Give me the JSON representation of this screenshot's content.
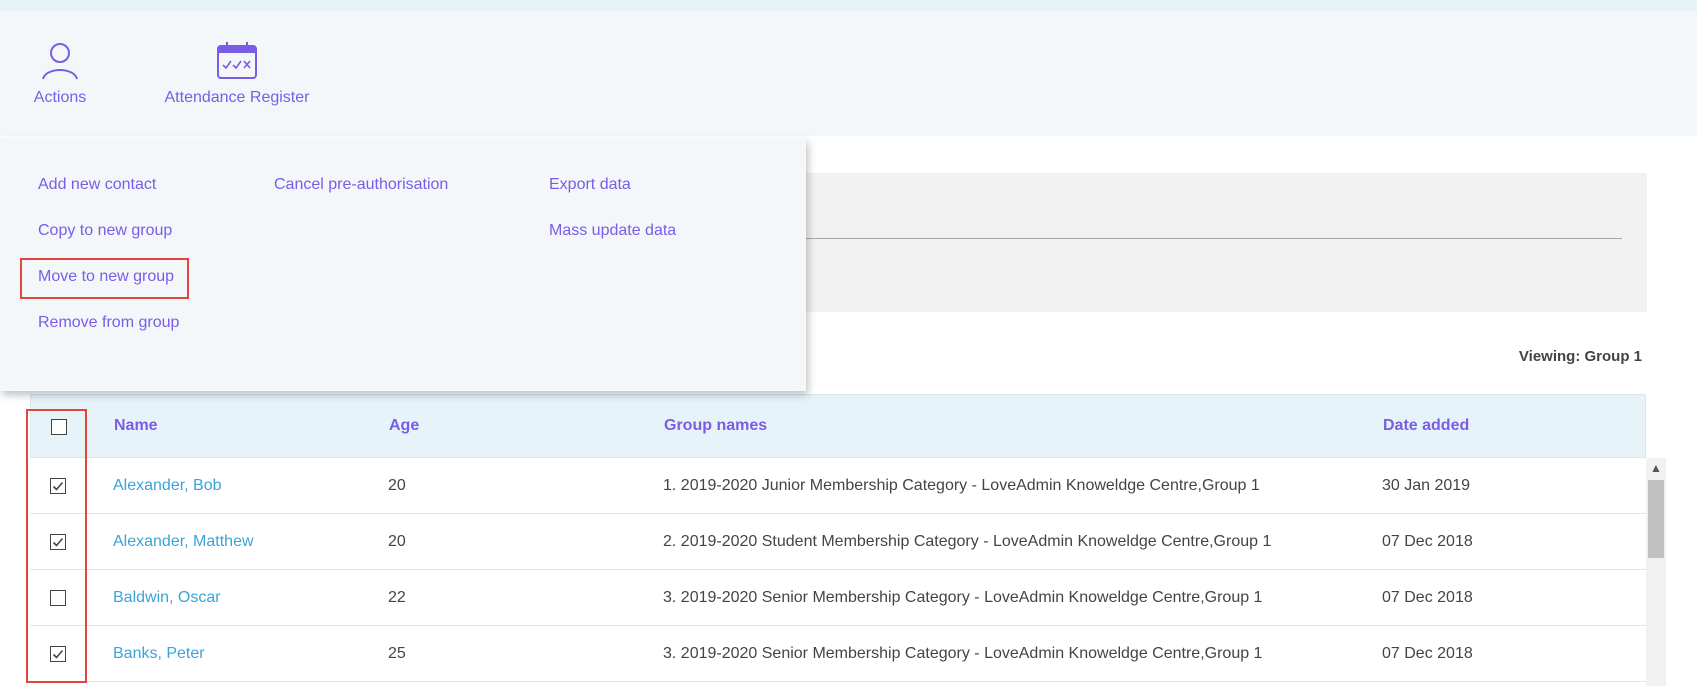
{
  "toolbar": {
    "actions_label": "Actions",
    "register_label": "Attendance Register"
  },
  "actions_menu": {
    "col1": [
      "Add new contact",
      "Copy to new group",
      "Move to new group",
      "Remove from group"
    ],
    "col2": [
      "Cancel pre-authorisation"
    ],
    "col3": [
      "Export data",
      "Mass update data"
    ]
  },
  "viewing_label": "Viewing: Group 1",
  "table": {
    "headers": {
      "name": "Name",
      "age": "Age",
      "group": "Group names",
      "date": "Date added"
    },
    "rows": [
      {
        "name": "Alexander, Bob",
        "age": "20",
        "group": "1. 2019-2020 Junior Membership Category - LoveAdmin Knoweldge Centre,Group 1",
        "date": "30 Jan 2019",
        "checked": true
      },
      {
        "name": "Alexander, Matthew",
        "age": "20",
        "group": "2. 2019-2020 Student Membership Category - LoveAdmin Knoweldge Centre,Group 1",
        "date": "07 Dec 2018",
        "checked": true
      },
      {
        "name": "Baldwin, Oscar",
        "age": "22",
        "group": "3. 2019-2020 Senior Membership Category - LoveAdmin Knoweldge Centre,Group 1",
        "date": "07 Dec 2018",
        "checked": false
      },
      {
        "name": "Banks, Peter",
        "age": "25",
        "group": "3. 2019-2020 Senior Membership Category - LoveAdmin Knoweldge Centre,Group 1",
        "date": "07 Dec 2018",
        "checked": true
      }
    ]
  },
  "colors": {
    "accent": "#7b5ce6",
    "link": "#3aa3d9",
    "highlight": "#e0463b",
    "header_bg": "#e6f4fa"
  },
  "icons": {
    "actions": "person-icon",
    "register": "calendar-check-icon",
    "check": "checkmark-icon",
    "scroll_up": "chevron-up-icon"
  }
}
